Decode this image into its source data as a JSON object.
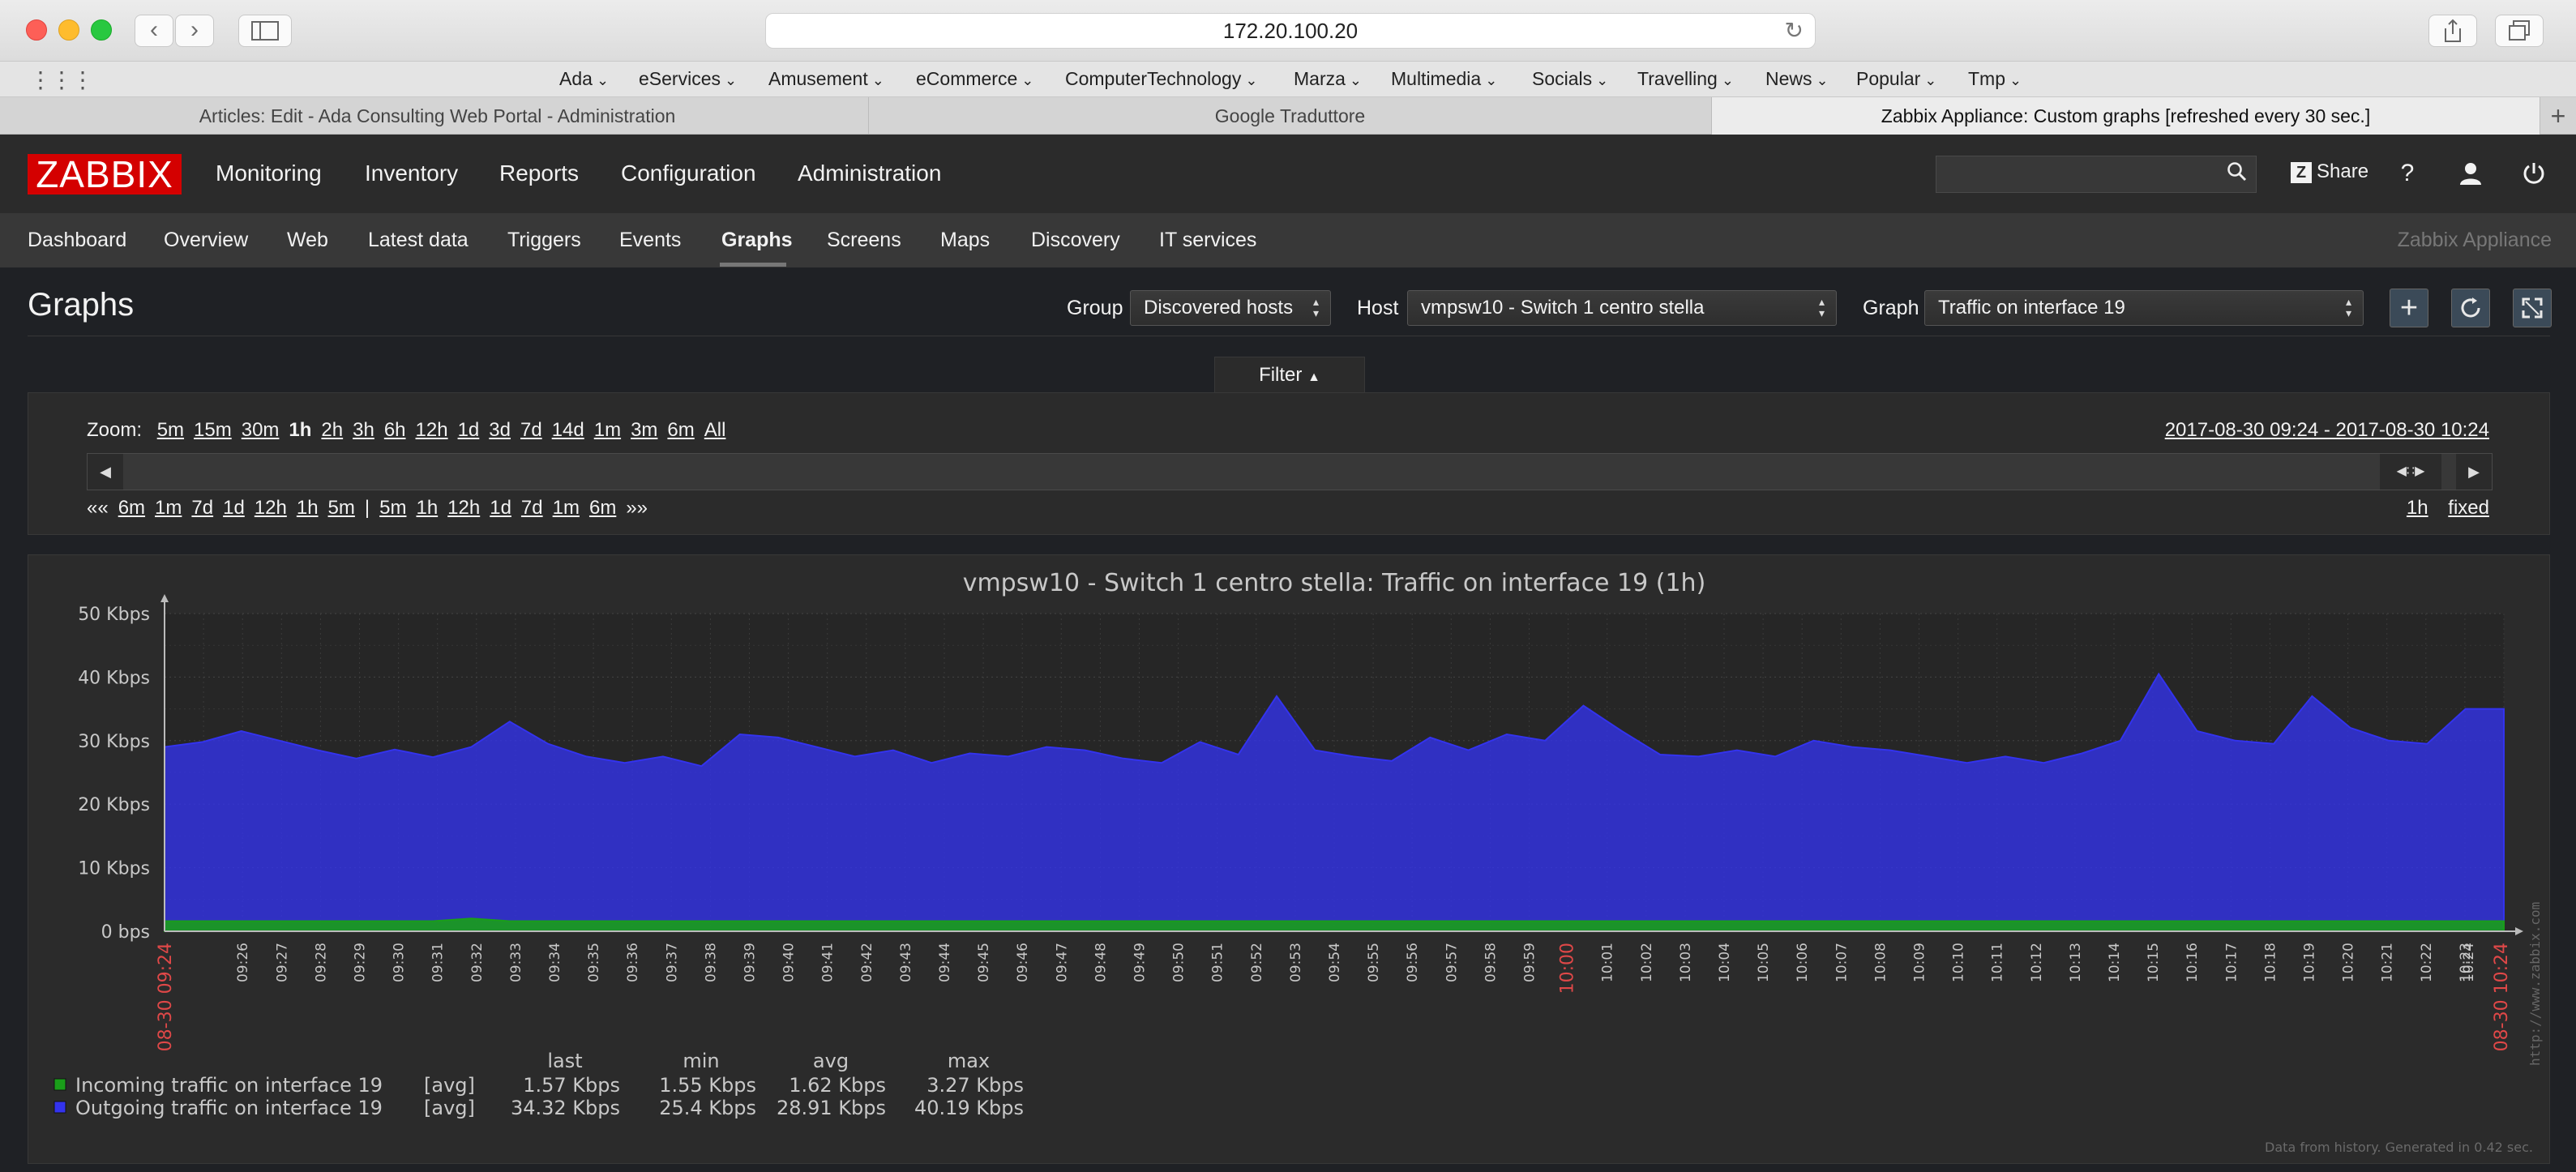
{
  "browser": {
    "url": "172.20.100.20",
    "favorites": [
      "Ada",
      "eServices",
      "Amusement",
      "eCommerce",
      "ComputerTechnology",
      "Marza",
      "Multimedia",
      "Socials",
      "Travelling",
      "News",
      "Popular",
      "Tmp"
    ],
    "tabs": [
      {
        "label": "Articles: Edit - Ada Consulting Web Portal - Administration",
        "active": false
      },
      {
        "label": "Google Traduttore",
        "active": false
      },
      {
        "label": "Zabbix Appliance: Custom graphs [refreshed every 30 sec.]",
        "active": true
      }
    ]
  },
  "header": {
    "logo": "ZABBIX",
    "main_nav": [
      "Monitoring",
      "Inventory",
      "Reports",
      "Configuration",
      "Administration"
    ],
    "share_label": "Share",
    "help": "?",
    "user_icon": "user-icon",
    "logout_icon": "power-icon"
  },
  "subnav": {
    "items": [
      "Dashboard",
      "Overview",
      "Web",
      "Latest data",
      "Triggers",
      "Events",
      "Graphs",
      "Screens",
      "Maps",
      "Discovery",
      "IT services"
    ],
    "active": "Graphs",
    "server_name": "Zabbix Appliance"
  },
  "page": {
    "title": "Graphs",
    "group_label": "Group",
    "group_value": "Discovered hosts",
    "host_label": "Host",
    "host_value": "vmpsw10 - Switch 1 centro stella",
    "graph_label": "Graph",
    "graph_value": "Traffic on interface 19"
  },
  "filter": {
    "tab_label": "Filter",
    "zoom_label": "Zoom:",
    "zoom_options": [
      "5m",
      "15m",
      "30m",
      "1h",
      "2h",
      "3h",
      "6h",
      "12h",
      "1d",
      "3d",
      "7d",
      "14d",
      "1m",
      "3m",
      "6m",
      "All"
    ],
    "zoom_active": "1h",
    "date_range": "2017-08-30 09:24 - 2017-08-30 10:24",
    "nav_back": [
      "««",
      "6m",
      "1m",
      "7d",
      "1d",
      "12h",
      "1h",
      "5m"
    ],
    "nav_sep": "|",
    "nav_forward": [
      "5m",
      "1h",
      "12h",
      "1d",
      "7d",
      "1m",
      "6m",
      "»»"
    ],
    "period": "1h",
    "fixed_label": "fixed"
  },
  "colors": {
    "incoming": "#1a9e1a",
    "outgoing": "#3333ee",
    "accent_red": "#d40000"
  },
  "chart_data": {
    "type": "area",
    "title": "vmpsw10 - Switch 1 centro stella: Traffic on interface 19 (1h)",
    "y_ticks": [
      "0 bps",
      "10 Kbps",
      "20 Kbps",
      "30 Kbps",
      "40 Kbps",
      "50 Kbps"
    ],
    "ylim": [
      0,
      50
    ],
    "x_start_label": "08-30 09:24",
    "x_end_label": "08-30 10:24",
    "x_labels": [
      "09:26",
      "09:27",
      "09:28",
      "09:29",
      "09:30",
      "09:31",
      "09:32",
      "09:33",
      "09:34",
      "09:35",
      "09:36",
      "09:37",
      "09:38",
      "09:39",
      "09:40",
      "09:41",
      "09:42",
      "09:43",
      "09:44",
      "09:45",
      "09:46",
      "09:47",
      "09:48",
      "09:49",
      "09:50",
      "09:51",
      "09:52",
      "09:53",
      "09:54",
      "09:55",
      "09:56",
      "09:57",
      "09:58",
      "09:59",
      "10:00",
      "10:01",
      "10:02",
      "10:03",
      "10:04",
      "10:05",
      "10:06",
      "10:07",
      "10:08",
      "10:09",
      "10:10",
      "10:11",
      "10:12",
      "10:13",
      "10:14",
      "10:15",
      "10:16",
      "10:17",
      "10:18",
      "10:19",
      "10:20",
      "10:21",
      "10:22",
      "10:23",
      "10:24"
    ],
    "highlight_label": "10:00",
    "series": [
      {
        "name": "Outgoing traffic on interface 19",
        "color": "#3333ee",
        "values": [
          29,
          29.8,
          31.5,
          30,
          28.5,
          27.2,
          28.6,
          27.4,
          29,
          33,
          29.5,
          27.5,
          26.5,
          27.5,
          26,
          31,
          30.5,
          29,
          27.5,
          28.5,
          26.5,
          28,
          27.5,
          29,
          28.5,
          27.2,
          26.5,
          29.8,
          27.8,
          37,
          28.5,
          27.5,
          26.8,
          30.5,
          28.5,
          31,
          30,
          35.5,
          31.5,
          27.8,
          27.5,
          28.5,
          27.5,
          30,
          29,
          28.5,
          27.5,
          26.5,
          27.5,
          26.5,
          28,
          30,
          40.5,
          31.5,
          30,
          29.5,
          37,
          32,
          30,
          29.5,
          35,
          35
        ]
      },
      {
        "name": "Incoming traffic on interface 19",
        "color": "#1a9e1a",
        "values": [
          1.6,
          1.6,
          1.6,
          1.6,
          1.6,
          1.6,
          1.6,
          1.6,
          2.0,
          1.6,
          1.6,
          1.6,
          1.6,
          1.6,
          1.6,
          1.6,
          1.6,
          1.6,
          1.6,
          1.6,
          1.6,
          1.6,
          1.6,
          1.6,
          1.6,
          1.6,
          1.6,
          1.6,
          1.6,
          1.6,
          1.6,
          1.6,
          1.6,
          1.6,
          1.6,
          1.6,
          1.6,
          1.6,
          1.6,
          1.6,
          1.6,
          1.6,
          1.6,
          1.6,
          1.6,
          1.6,
          1.6,
          1.6,
          1.6,
          1.6,
          1.6,
          1.6,
          1.6,
          1.6,
          1.6,
          1.6,
          1.6,
          1.6,
          1.6,
          1.6,
          1.6,
          1.6
        ]
      }
    ],
    "legend_headers": [
      "last",
      "min",
      "avg",
      "max"
    ],
    "legend": [
      {
        "name": "Incoming traffic on interface 19",
        "color": "#1a9e1a",
        "func": "[avg]",
        "last": "1.57 Kbps",
        "min": "1.55 Kbps",
        "avg": "1.62 Kbps",
        "max": "3.27 Kbps"
      },
      {
        "name": "Outgoing traffic on interface 19",
        "color": "#3333ee",
        "func": "[avg]",
        "last": "34.32 Kbps",
        "min": "25.4 Kbps",
        "avg": "28.91 Kbps",
        "max": "40.19 Kbps"
      }
    ],
    "watermark": "http://www.zabbix.com",
    "footer_note": "Data from history. Generated in 0.42 sec."
  }
}
